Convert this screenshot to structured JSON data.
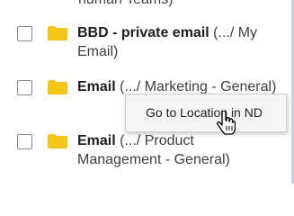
{
  "list": {
    "partial_top_text": "numan Teams)",
    "items": [
      {
        "title": "BBD - private email",
        "path": "(.../ My Email)",
        "checked": false,
        "icon": "folder-icon"
      },
      {
        "title": "Email",
        "path": "(.../ Marketing - General)",
        "checked": false,
        "icon": "folder-icon"
      },
      {
        "title": "Email",
        "path": "(.../ Product Management - General)",
        "checked": false,
        "icon": "folder-icon"
      }
    ]
  },
  "context_menu": {
    "item": "Go to Location in ND"
  },
  "colors": {
    "folder": "#f5c518",
    "border": "#c9d3df"
  }
}
